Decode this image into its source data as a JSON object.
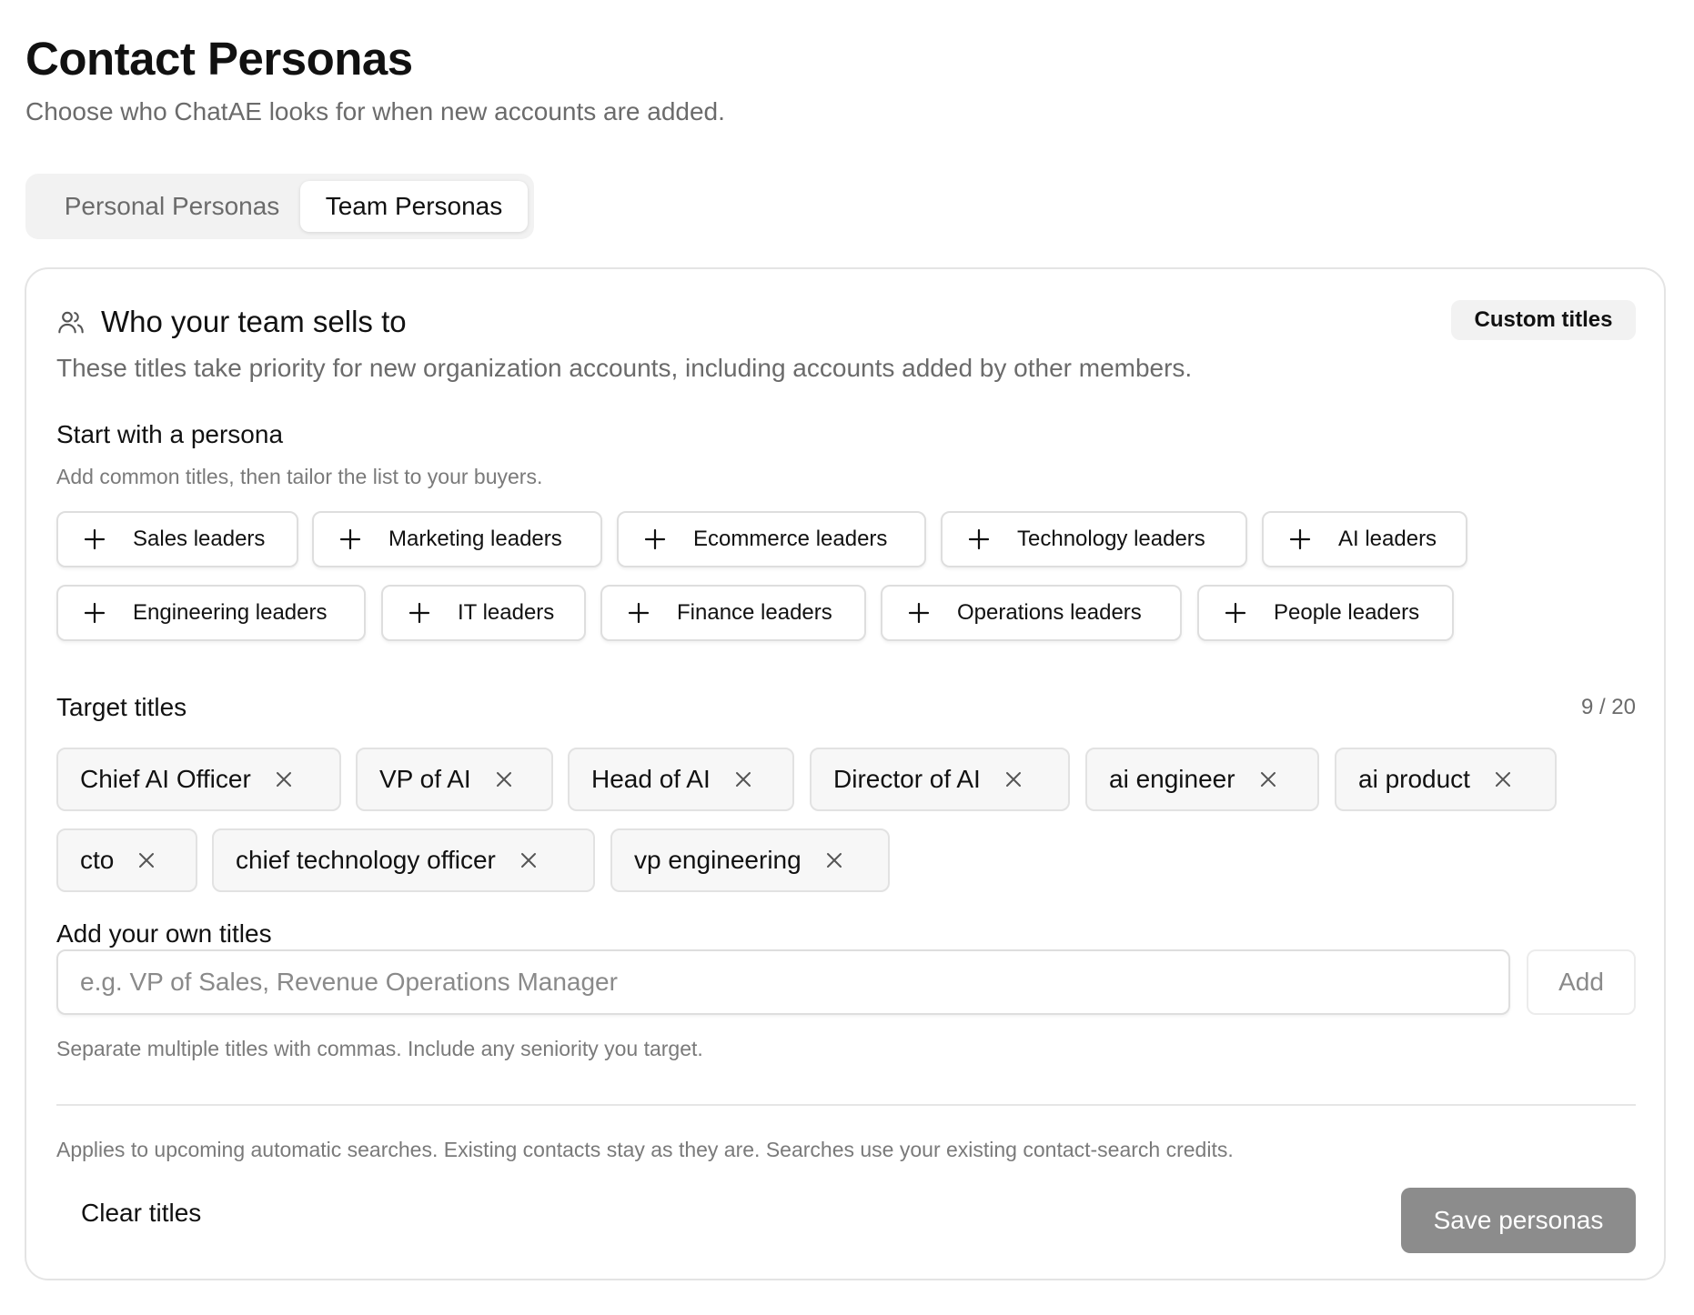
{
  "page": {
    "title": "Contact Personas",
    "subtitle": "Choose who ChatAE looks for when new accounts are added."
  },
  "tabs": {
    "personal": "Personal Personas",
    "team": "Team Personas",
    "active": "Team Personas"
  },
  "card": {
    "title": "Who your team sells to",
    "badge": "Custom titles",
    "description": "These titles take priority for new organization accounts, including accounts added by other members."
  },
  "personas": {
    "heading": "Start with a persona",
    "hint": "Add common titles, then tailor the list to your buyers.",
    "items": [
      "Sales leaders",
      "Marketing leaders",
      "Ecommerce leaders",
      "Technology leaders",
      "AI leaders",
      "Engineering leaders",
      "IT leaders",
      "Finance leaders",
      "Operations leaders",
      "People leaders"
    ]
  },
  "target_titles": {
    "heading": "Target titles",
    "count": "9 / 20",
    "items": [
      "Chief AI Officer",
      "VP of AI",
      "Head of AI",
      "Director of AI",
      "ai engineer",
      "ai product",
      "cto",
      "chief technology officer",
      "vp engineering"
    ]
  },
  "custom_titles": {
    "heading": "Add your own titles",
    "placeholder": "e.g. VP of Sales, Revenue Operations Manager",
    "value": "",
    "add_label": "Add",
    "hint": "Separate multiple titles with commas. Include any seniority you target."
  },
  "footer": {
    "note": "Applies to upcoming automatic searches. Existing contacts stay as they are. Searches use your existing contact-search credits.",
    "clear_label": "Clear titles",
    "save_label": "Save personas"
  },
  "icons": {
    "header": "users-icon",
    "persona_add": "plus-icon",
    "chip_remove": "close-icon"
  },
  "colors": {
    "text": "#111111",
    "muted": "#6b6b6b",
    "border": "#e4e4e4",
    "tab_track": "#f2f2f2",
    "chip_bg": "#f7f7f7",
    "save_disabled": "#8c8c8c"
  }
}
